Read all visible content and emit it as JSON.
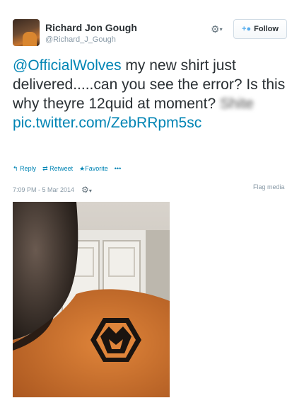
{
  "author": {
    "name": "Richard Jon Gough",
    "handle": "@Richard_J_Gough"
  },
  "header_actions": {
    "gear_icon": "gear-icon",
    "follow_label": "Follow",
    "follow_icon": "person-plus-icon"
  },
  "tweet": {
    "mention": "@OfficialWolves",
    "text": " my new shirt just delivered.....can you see the error? Is this why theyre 12quid at moment? ",
    "blurred_word": "Shite",
    "link": "pic.twitter.com/ZebRRpm5sc"
  },
  "actions": {
    "reply": "Reply",
    "retweet": "Retweet",
    "favorite": "Favorite",
    "more": "•••"
  },
  "meta": {
    "timestamp": "7:09 PM - 5 Mar 2014",
    "flag_label": "Flag media"
  },
  "colors": {
    "link": "#0084b4",
    "shirt_orange": "#d9772d",
    "badge_black": "#1a1410"
  }
}
